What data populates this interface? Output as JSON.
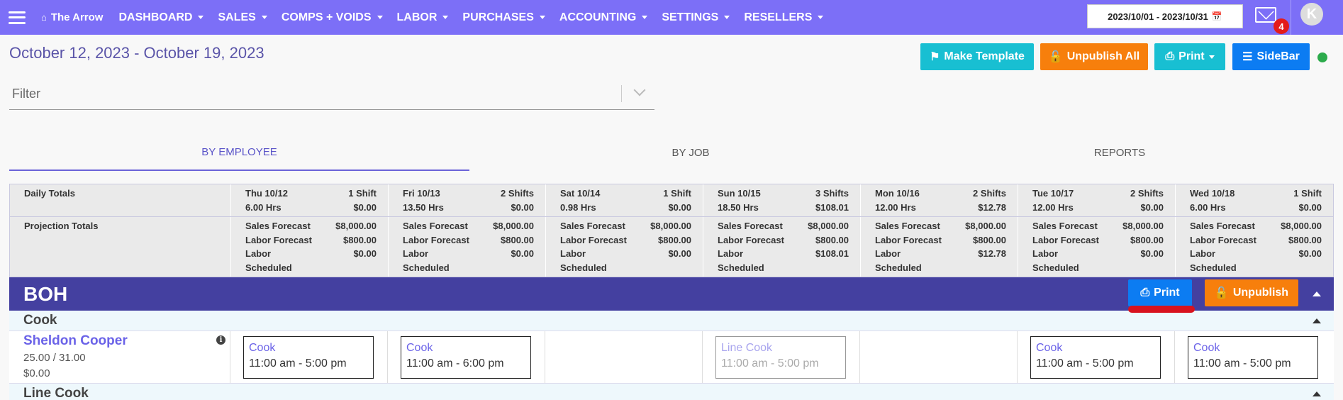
{
  "nav": {
    "brand": "The Arrow",
    "items": [
      "DASHBOARD",
      "SALES",
      "COMPS + VOIDS",
      "LABOR",
      "PURCHASES",
      "ACCOUNTING",
      "SETTINGS",
      "RESELLERS"
    ],
    "date_range": "2023/10/01 - 2023/10/31",
    "mail_count": "4",
    "avatar_letter": "K"
  },
  "header": {
    "date_title": "October 12, 2023 - October 19, 2023",
    "buttons": {
      "make_template": "Make Template",
      "unpublish_all": "Unpublish All",
      "print": "Print",
      "sidebar": "SideBar"
    },
    "filter_placeholder": "Filter"
  },
  "tabs": [
    "BY EMPLOYEE",
    "BY JOB",
    "REPORTS"
  ],
  "totals": {
    "daily_label": "Daily Totals",
    "projection_label": "Projection Totals",
    "projection_keys": [
      "Sales Forecast",
      "Labor Forecast",
      "Labor",
      "Scheduled"
    ],
    "days": [
      {
        "day": "Thu 10/12",
        "shifts": "1 Shift",
        "hrs": "6.00 Hrs",
        "cost": "$0.00",
        "sales": "$8,000.00",
        "labor_forecast": "$800.00",
        "labor": "$0.00"
      },
      {
        "day": "Fri 10/13",
        "shifts": "2 Shifts",
        "hrs": "13.50 Hrs",
        "cost": "$0.00",
        "sales": "$8,000.00",
        "labor_forecast": "$800.00",
        "labor": "$0.00"
      },
      {
        "day": "Sat 10/14",
        "shifts": "1 Shift",
        "hrs": "0.98 Hrs",
        "cost": "$0.00",
        "sales": "$8,000.00",
        "labor_forecast": "$800.00",
        "labor": "$0.00"
      },
      {
        "day": "Sun 10/15",
        "shifts": "3 Shifts",
        "hrs": "18.50 Hrs",
        "cost": "$108.01",
        "sales": "$8,000.00",
        "labor_forecast": "$800.00",
        "labor": "$108.01"
      },
      {
        "day": "Mon 10/16",
        "shifts": "2 Shifts",
        "hrs": "12.00 Hrs",
        "cost": "$12.78",
        "sales": "$8,000.00",
        "labor_forecast": "$800.00",
        "labor": "$12.78"
      },
      {
        "day": "Tue 10/17",
        "shifts": "2 Shifts",
        "hrs": "12.00 Hrs",
        "cost": "$0.00",
        "sales": "$8,000.00",
        "labor_forecast": "$800.00",
        "labor": "$0.00"
      },
      {
        "day": "Wed 10/18",
        "shifts": "1 Shift",
        "hrs": "6.00 Hrs",
        "cost": "$0.00",
        "sales": "$8,000.00",
        "labor_forecast": "$800.00",
        "labor": "$0.00"
      }
    ]
  },
  "section": {
    "title": "BOH",
    "print": "Print",
    "unpublish": "Unpublish"
  },
  "jobs": [
    "Cook",
    "Line Cook"
  ],
  "employee": {
    "name": "Sheldon Cooper",
    "rate": "25.00 / 31.00",
    "cost": "$0.00",
    "shifts": [
      {
        "job": "Cook",
        "time": "11:00 am - 5:00 pm",
        "faded": false
      },
      {
        "job": "Cook",
        "time": "11:00 am - 6:00 pm",
        "faded": false
      },
      null,
      {
        "job": "Line Cook",
        "time": "11:00 am - 5:00 pm",
        "faded": true
      },
      null,
      {
        "job": "Cook",
        "time": "11:00 am - 5:00 pm",
        "faded": false
      },
      {
        "job": "Cook",
        "time": "11:00 am - 5:00 pm",
        "faded": false
      }
    ]
  },
  "colors": {
    "navbar": "#7c6ff7",
    "section": "#4440a0",
    "teal": "#18bfd2",
    "orange": "#f77f0c",
    "blue": "#0c7cf2",
    "status": "#2cab4c"
  }
}
